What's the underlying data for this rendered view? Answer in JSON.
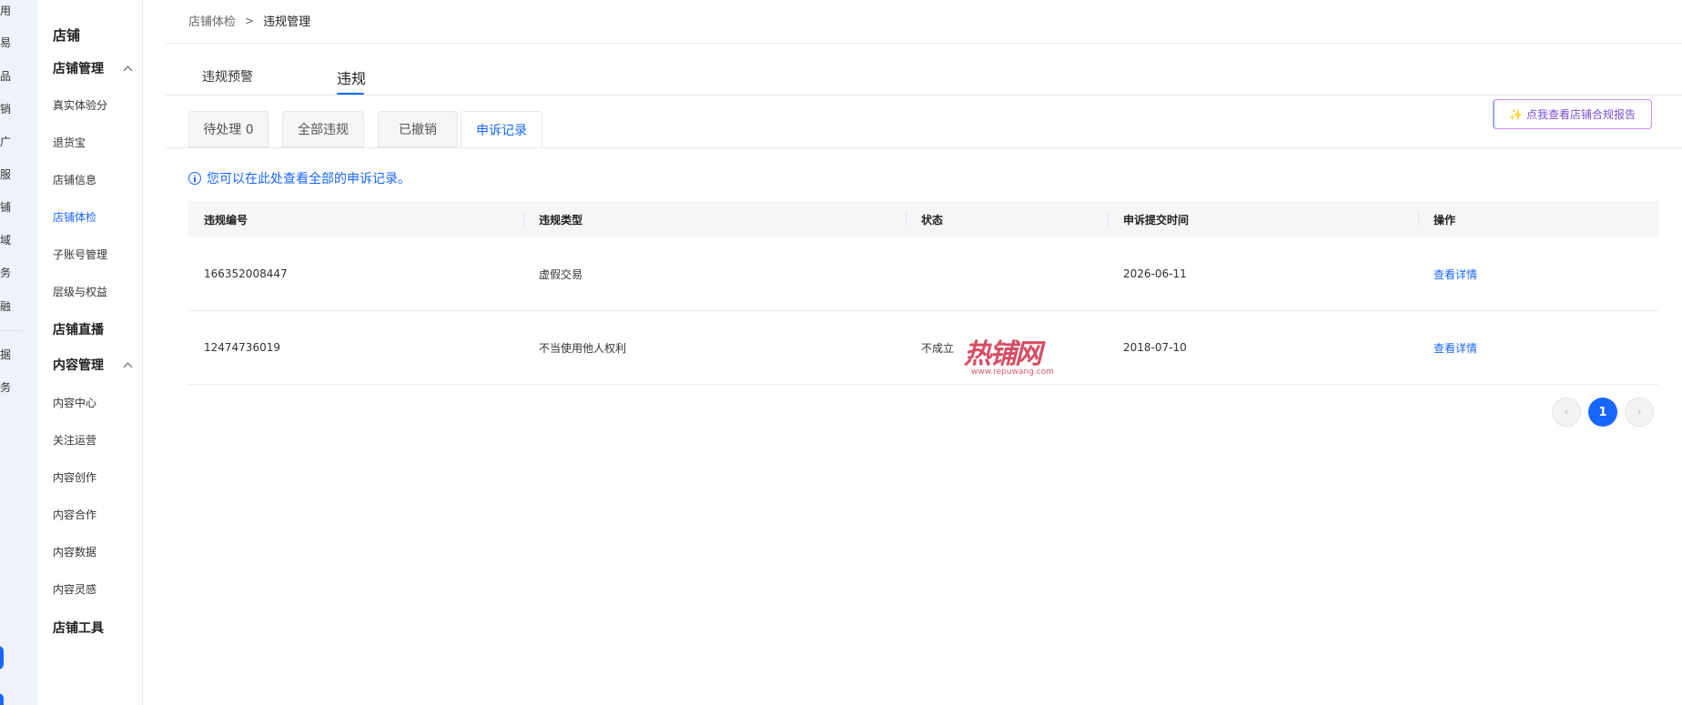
{
  "rail": {
    "items": [
      "用",
      "易",
      "品",
      "销",
      "广",
      "服",
      "铺",
      "域",
      "务",
      "融",
      "据",
      "务"
    ]
  },
  "sidebar": {
    "title": "店铺",
    "group_shop_manage": "店铺管理",
    "shop_items": [
      "真实体验分",
      "退货宝",
      "店铺信息",
      "店铺体检",
      "子账号管理",
      "层级与权益"
    ],
    "group_live": "店铺直播",
    "group_content": "内容管理",
    "content_items": [
      "内容中心",
      "关注运营",
      "内容创作",
      "内容合作",
      "内容数据",
      "内容灵感"
    ],
    "group_tools": "店铺工具"
  },
  "breadcrumb": {
    "first": "店铺体检",
    "sep": ">",
    "current": "违规管理"
  },
  "top_tabs": [
    "违规预警",
    "违规"
  ],
  "seg_tabs": [
    "待处理 0",
    "全部违规",
    "已撤销",
    "申诉记录"
  ],
  "report_button": {
    "icon": "sparkle-icon",
    "label": "点我查看店铺合规报告"
  },
  "info_text": "您可以在此处查看全部的申诉记录。",
  "table": {
    "headers": [
      "违规编号",
      "违规类型",
      "状态",
      "申诉提交时间",
      "操作"
    ],
    "rows": [
      {
        "id": "166352008447",
        "type": "虚假交易",
        "status": "",
        "time": "2026-06-11",
        "action": "查看详情"
      },
      {
        "id": "12474736019",
        "type": "不当使用他人权利",
        "status": "不成立",
        "time": "2018-07-10",
        "action": "查看详情"
      }
    ]
  },
  "pagination": {
    "current": "1"
  },
  "watermark": {
    "main": "热铺网",
    "sub": "www.repuwang.com"
  },
  "colors": {
    "accent": "#1966ff",
    "report_border": "#d48cf0",
    "watermark": "#d0304a"
  }
}
